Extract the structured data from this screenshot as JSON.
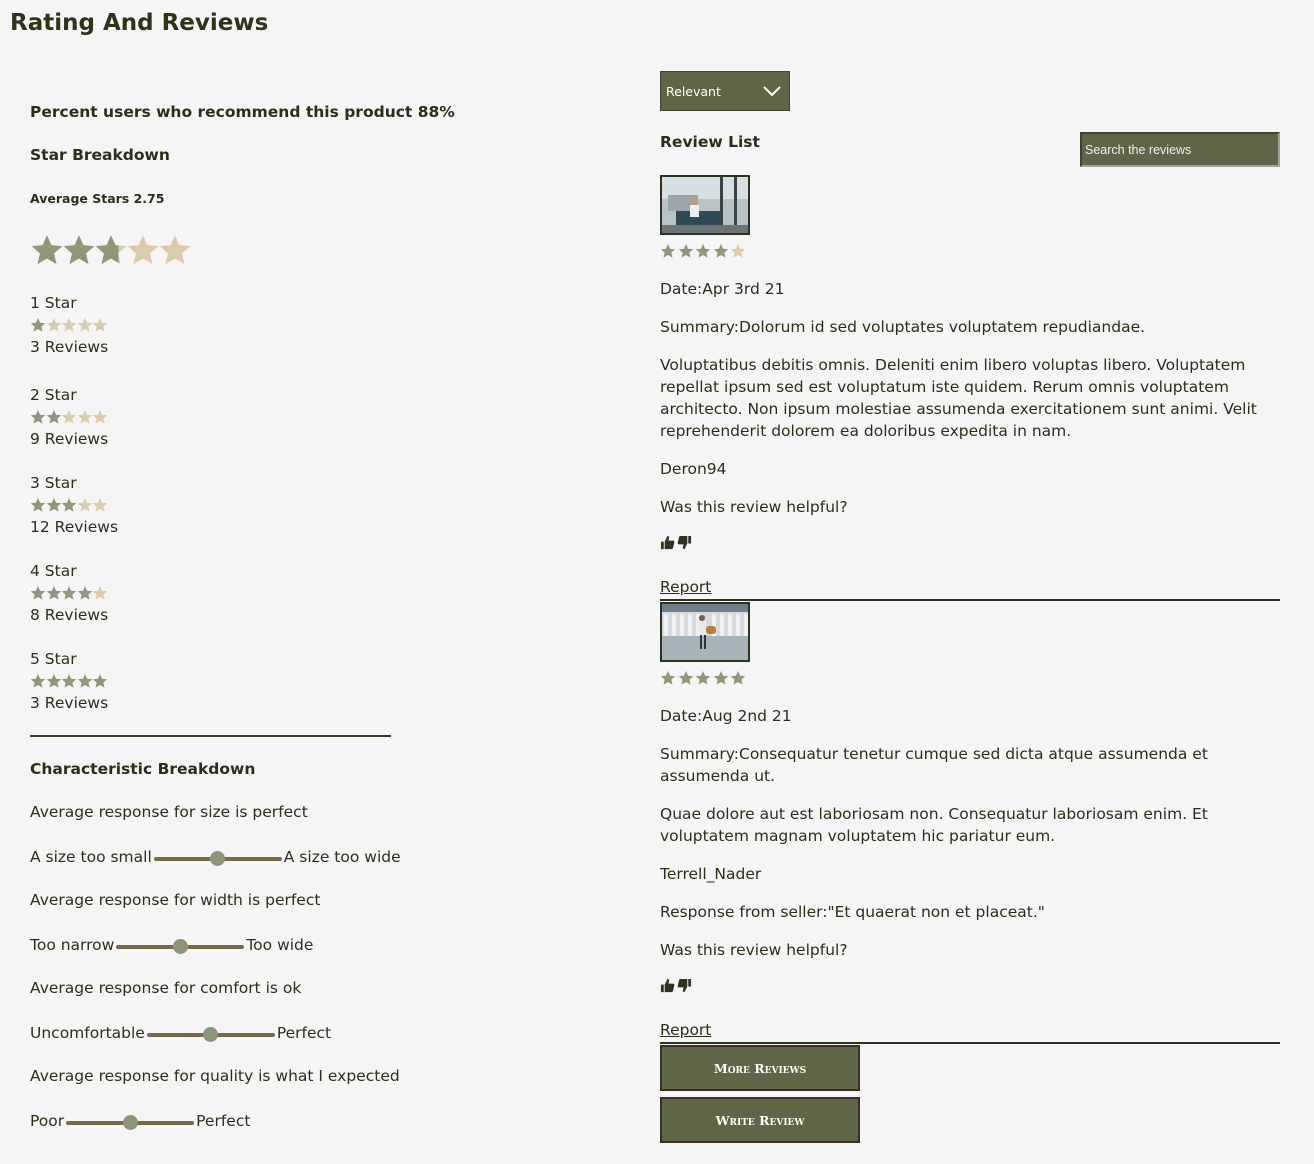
{
  "page_title": "Rating And Reviews",
  "ratings": {
    "recommend_text": "Percent users who recommend this product 88%",
    "star_breakdown_title": "Star Breakdown",
    "average_text": "Average Stars 2.75",
    "average_value": 2.75,
    "rows": [
      {
        "label": "1 Star",
        "stars": 1,
        "count": "3 Reviews"
      },
      {
        "label": "2 Star",
        "stars": 2,
        "count": "9 Reviews"
      },
      {
        "label": "3 Star",
        "stars": 3,
        "count": "12 Reviews"
      },
      {
        "label": "4 Star",
        "stars": 4,
        "count": "8 Reviews"
      },
      {
        "label": "5 Star",
        "stars": 5,
        "count": "3 Reviews"
      }
    ]
  },
  "characteristics": {
    "title": "Characteristic Breakdown",
    "items": [
      {
        "summary": "Average response for size is perfect",
        "low": "A size too small",
        "high": "A size too wide",
        "level": 0.5
      },
      {
        "summary": "Average response for width is perfect",
        "low": "Too narrow",
        "high": "Too wide",
        "level": 0.5
      },
      {
        "summary": "Average response for comfort is ok",
        "low": "Uncomfortable",
        "high": "Perfect",
        "level": 0.5
      },
      {
        "summary": "Average response for quality is what I expected",
        "low": "Poor",
        "high": "Perfect",
        "level": 0.5
      }
    ]
  },
  "reviews_panel": {
    "sort_selected": "Relevant",
    "list_title": "Review List",
    "search_placeholder": "Search the reviews",
    "more_reviews": "More Reviews",
    "write_review": "Write Review",
    "reviews": [
      {
        "stars": 4,
        "date": "Date:Apr 3rd 21",
        "summary": "Summary:Dolorum id sed voluptates voluptatem repudiandae.",
        "body": "Voluptatibus debitis omnis. Deleniti enim libero voluptas libero. Voluptatem repellat ipsum sed est voluptatum iste quidem. Rerum omnis voluptatem architecto. Non ipsum molestiae assumenda exercitationem sunt animi. Velit reprehenderit dolorem ea doloribus expedita in nam.",
        "user": "Deron94",
        "helpful": "Was this review helpful?",
        "report": "Report"
      },
      {
        "stars": 5,
        "date": "Date:Aug 2nd 21",
        "summary": "Summary:Consequatur tenetur cumque sed dicta atque assumenda et assumenda ut.",
        "body": "Quae dolore aut est laboriosam non. Consequatur laboriosam enim. Et voluptatem magnam voluptatem hic pariatur eum.",
        "user": "Terrell_Nader",
        "response": "Response from seller:\"Et quaerat non et placeat.\"",
        "helpful": "Was this review helpful?",
        "report": "Report"
      }
    ]
  },
  "colors": {
    "star_filled": "#8f9679",
    "star_empty": "#d9ccaa",
    "accent": "#5f6647",
    "slider_track": "#7b6a49"
  },
  "icons": [
    "star-icon",
    "chevron-down-icon",
    "thumbs-up-icon",
    "thumbs-down-icon"
  ]
}
